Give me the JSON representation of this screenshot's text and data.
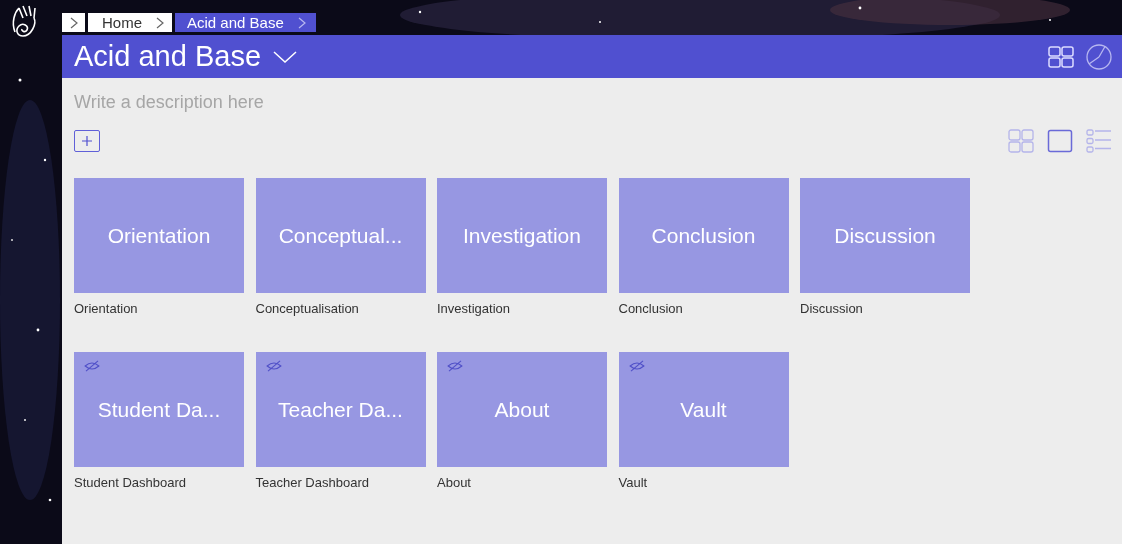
{
  "breadcrumb": [
    {
      "label": "Home",
      "current": false
    },
    {
      "label": "Acid and Base",
      "current": true
    }
  ],
  "header": {
    "title": "Acid and Base"
  },
  "description": {
    "placeholder": "Write a description here"
  },
  "view_modes": [
    {
      "kind": "grid",
      "selected": false
    },
    {
      "kind": "single",
      "selected": true
    },
    {
      "kind": "list",
      "selected": false
    }
  ],
  "tiles": [
    {
      "title": "Orientation",
      "label": "Orientation",
      "hidden": false
    },
    {
      "title": "Conceptual...",
      "label": "Conceptualisation",
      "hidden": false
    },
    {
      "title": "Investigation",
      "label": "Investigation",
      "hidden": false
    },
    {
      "title": "Conclusion",
      "label": "Conclusion",
      "hidden": false
    },
    {
      "title": "Discussion",
      "label": "Discussion",
      "hidden": false
    },
    {
      "title": "Student Da...",
      "label": "Student Dashboard",
      "hidden": true
    },
    {
      "title": "Teacher Da...",
      "label": "Teacher Dashboard",
      "hidden": true
    },
    {
      "title": "About",
      "label": "About",
      "hidden": true
    },
    {
      "title": "Vault",
      "label": "Vault",
      "hidden": true
    }
  ]
}
